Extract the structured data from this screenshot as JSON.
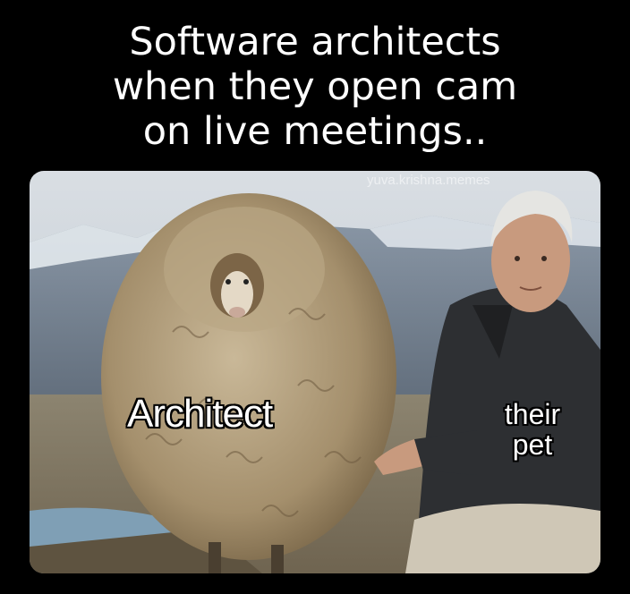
{
  "caption": {
    "line1": "Software architects",
    "line2": "when they open cam",
    "line3": "on live meetings.."
  },
  "watermark": "yuva.krishna.memes",
  "labels": {
    "sheep": "Architect",
    "man_line1": "their",
    "man_line2": "pet"
  }
}
